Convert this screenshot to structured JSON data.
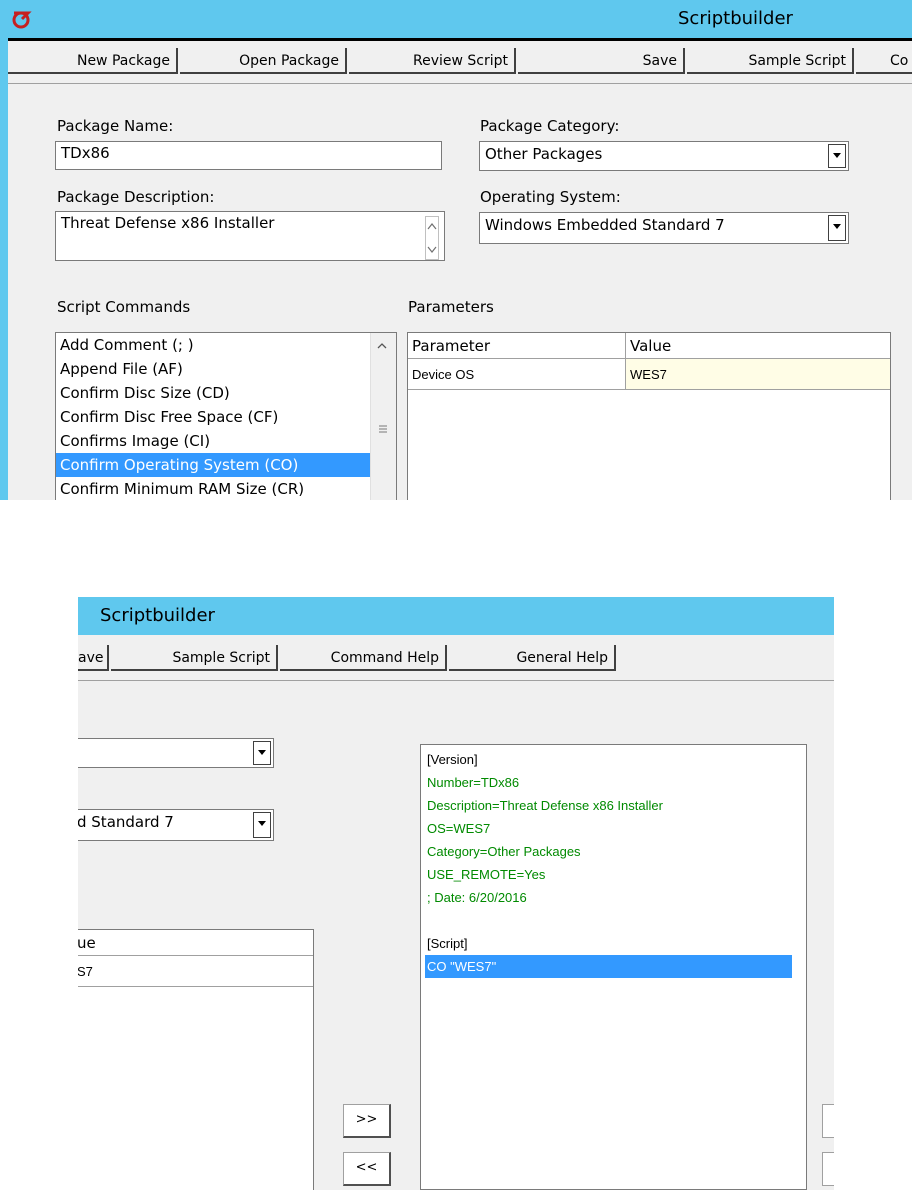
{
  "window": {
    "title": "Scriptbuilder"
  },
  "toolbar": {
    "new_package": "New Package",
    "open_package": "Open Package",
    "review_script": "Review Script",
    "save": "Save",
    "sample_script": "Sample Script",
    "command_help_partial": "Co",
    "save_partial": "ave",
    "command_help": "Command Help",
    "general_help": "General Help"
  },
  "form": {
    "package_name_label": "Package Name:",
    "package_name_value": "TDx86",
    "package_category_label": "Package Category:",
    "package_category_value": "Other Packages",
    "package_description_label": "Package Description:",
    "package_description_value": "Threat Defense x86 Installer",
    "operating_system_label": "Operating System:",
    "operating_system_value": "Windows Embedded Standard 7",
    "operating_system_value_partial": "d Standard 7"
  },
  "commands": {
    "label": "Script Commands",
    "items": [
      "Add Comment (; )",
      "Append File (AF)",
      "Confirm Disc Size (CD)",
      "Confirm Disc Free Space (CF)",
      "Confirms Image (CI)",
      "Confirm Operating System (CO)",
      "Confirm Minimum RAM Size (CR)"
    ],
    "selected_index": 5
  },
  "parameters": {
    "label": "Parameters",
    "col_parameter": "Parameter",
    "col_value": "Value",
    "col_value_partial": "ue",
    "row_parameter": "Device OS",
    "row_value": "WES7",
    "row_value_partial": "S7"
  },
  "script": {
    "lines": [
      {
        "text": "[Version]",
        "style": "plain"
      },
      {
        "text": "Number=TDx86",
        "style": "green"
      },
      {
        "text": "Description=Threat Defense x86 Installer",
        "style": "green"
      },
      {
        "text": "OS=WES7",
        "style": "green"
      },
      {
        "text": "Category=Other Packages",
        "style": "green"
      },
      {
        "text": "USE_REMOTE=Yes",
        "style": "green"
      },
      {
        "text": "; Date: 6/20/2016",
        "style": "green"
      },
      {
        "text": "",
        "style": "plain"
      },
      {
        "text": "[Script]",
        "style": "plain"
      },
      {
        "text": "CO \"WES7\"",
        "style": "sel"
      }
    ]
  },
  "move_buttons": {
    "add": ">>",
    "remove": "<<"
  },
  "colors": {
    "titlebar": "#5fc8ee",
    "selection": "#3399ff",
    "script_text_green": "#008a00",
    "edit_cell": "#fffde6"
  }
}
